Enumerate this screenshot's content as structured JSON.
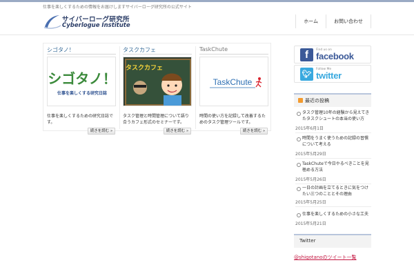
{
  "header": {
    "tagline": "仕事を楽しくするための情報をお届けしますサイバーローグ研究所の公式サイト",
    "logo_jp": "サイバーローグ研究所",
    "logo_en": "Cyberlogue Institute",
    "nav": [
      "ホーム",
      "お問い合わせ"
    ]
  },
  "cards": [
    {
      "title": "シゴタノ！",
      "image_text": "シゴタノ！",
      "image_sub": "仕事を楽しくする研究日誌",
      "excerpt": "仕事を楽しくするための研究日誌です。",
      "more": "続きを読む »"
    },
    {
      "title": "タスクカフェ",
      "image_text": "タスクカフェ",
      "excerpt": "タスク管理と時間管理について語り合うカフェ形式のセミナーです。",
      "more": "続きを読む »"
    },
    {
      "title": "TaskChute",
      "image_text": "TaskChute",
      "excerpt": "時間の使い方を記録して改善するためのタスク管理ツールです。",
      "more": "続きを読む »"
    }
  ],
  "social": {
    "facebook_small": "Find us on",
    "facebook_big": "facebook",
    "twitter_small": "Follow Me",
    "twitter_big": "twitter"
  },
  "recent": {
    "title": "最近の投稿",
    "posts": [
      {
        "title": "タスク管理10年の経験から見えてきたタスクシュートの本当の使い方",
        "date": "2015年6月1日"
      },
      {
        "title": "時間をうまく使うための記録の習慣について考える",
        "date": "2015年5月29日"
      },
      {
        "title": "TaskChuteで今日やるべきことを見極める方法",
        "date": "2015年5月26日"
      },
      {
        "title": "一日の計画を立てるときに気をつけたい三つのこととその理由",
        "date": "2015年5月25日"
      },
      {
        "title": "仕事を楽しくするための小さな工夫",
        "date": "2015年5月21日"
      }
    ]
  },
  "twitter_widget": {
    "title": "Twitter",
    "link": "@shigotanoのツイート一覧"
  },
  "colors": {
    "accent": "#3a6e9a",
    "facebook": "#3b5998",
    "twitter": "#39a9df",
    "link": "#c4143f"
  }
}
